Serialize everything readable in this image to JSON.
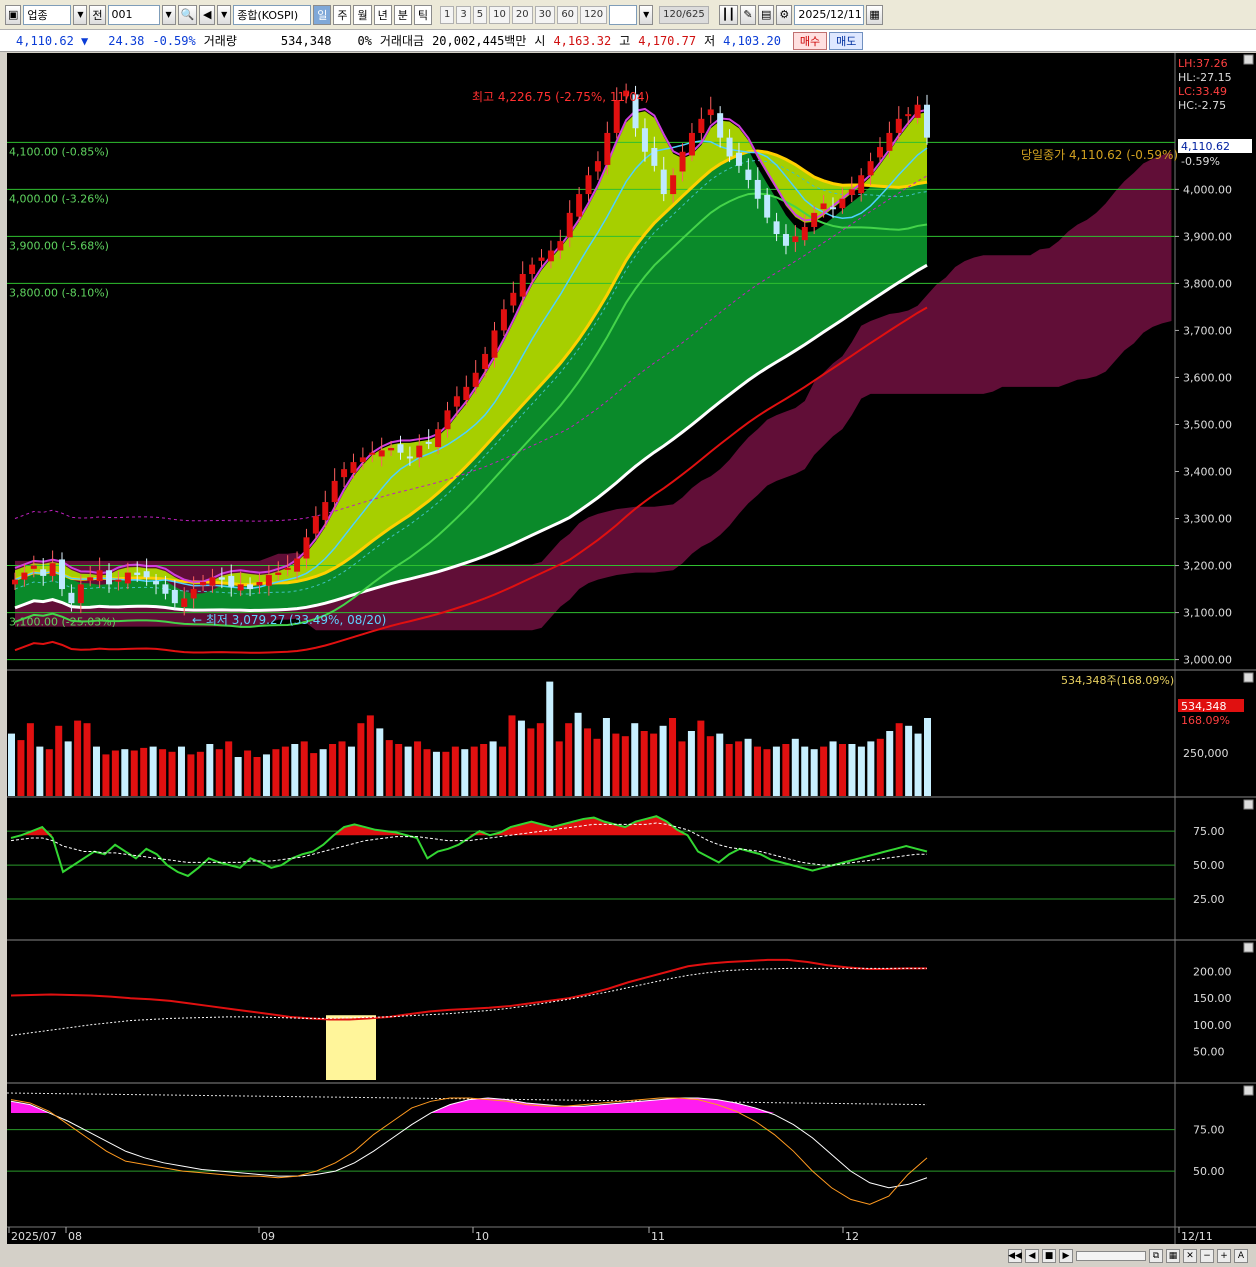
{
  "toolbar": {
    "market_select": "업종",
    "prev_label": "전",
    "code": "001",
    "name": "종합(KOSPI)",
    "periods": [
      "일",
      "주",
      "월",
      "년",
      "분",
      "틱"
    ],
    "active_period": "일",
    "intervals": [
      "1",
      "3",
      "5",
      "10",
      "20",
      "30",
      "60",
      "120"
    ],
    "count": "120",
    "total": "/625",
    "date": "2025/12/11"
  },
  "quote": {
    "price": "4,110.62",
    "change": "24.38",
    "change_pct": "-0.59%",
    "volume_label": "거래량",
    "volume": "534,348",
    "volume_pct": "0%",
    "amount_label": "거래대금",
    "amount": "20,002,445백만",
    "open_label": "시",
    "open": "4,163.32",
    "high_label": "고",
    "high": "4,170.77",
    "low_label": "저",
    "low": "4,103.20",
    "buy": "매수",
    "sell": "매도"
  },
  "chart_data": [
    {
      "type": "candlestick",
      "title": "",
      "x_labels": [
        "2025/07",
        "08",
        "09",
        "10",
        "11",
        "12",
        "12/11"
      ],
      "ylim": [
        2980,
        4290
      ],
      "y_ticks": [
        3000,
        3100,
        3200,
        3300,
        3400,
        3500,
        3600,
        3700,
        3800,
        3900,
        4000,
        4100
      ],
      "y_tick_labels": [
        "3,000.00",
        "3,100.00",
        "3,200.00",
        "3,300.00",
        "3,400.00",
        "3,500.00",
        "3,600.00",
        "3,700.00",
        "3,800.00",
        "3,900.00",
        "4,000.00"
      ],
      "level_lines": [
        {
          "price": 4100,
          "label": "4,100.00 (-0.85%)"
        },
        {
          "price": 4000,
          "label": "4,000.00 (-3.26%)"
        },
        {
          "price": 3900,
          "label": "3,900.00 (-5.68%)"
        },
        {
          "price": 3800,
          "label": "3,800.00 (-8.10%)"
        },
        {
          "price": 3200,
          "label": ""
        },
        {
          "price": 3100,
          "label": "3,100.00 (-25.03%)"
        },
        {
          "price": 3000,
          "label": ""
        }
      ],
      "annotations": {
        "high": "최고 4,226.75 (-2.75%, 11/04)",
        "low": "최저 3,079.27 (33.49%, 08/20)",
        "prev_close": "당일종가 4,110.62 (-0.59%)",
        "last_price": "4,110.62",
        "last_pct": "-0.59%",
        "lh": "LH:37.26",
        "hl": "HL:-27.15",
        "lc": "LC:33.49",
        "hc": "HC:-2.75"
      },
      "closes": [
        3170,
        3185,
        3200,
        3178,
        3205,
        3150,
        3120,
        3160,
        3175,
        3190,
        3160,
        3170,
        3185,
        3180,
        3175,
        3160,
        3140,
        3120,
        3130,
        3150,
        3165,
        3175,
        3170,
        3155,
        3160,
        3150,
        3165,
        3180,
        3185,
        3195,
        3215,
        3260,
        3305,
        3335,
        3380,
        3405,
        3420,
        3430,
        3440,
        3445,
        3450,
        3440,
        3430,
        3455,
        3460,
        3490,
        3530,
        3560,
        3580,
        3610,
        3650,
        3700,
        3745,
        3780,
        3820,
        3840,
        3855,
        3870,
        3890,
        3950,
        3990,
        4030,
        4060,
        4120,
        4190,
        4210,
        4130,
        4080,
        4050,
        3990,
        4030,
        4080,
        4120,
        4150,
        4170,
        4110,
        4070,
        4050,
        4020,
        3980,
        3940,
        3905,
        3880,
        3900,
        3920,
        3950,
        3970,
        3960,
        3980,
        4000,
        4030,
        4060,
        4090,
        4120,
        4150,
        4160,
        4180,
        4110
      ]
    },
    {
      "type": "bar",
      "title": "",
      "label": "534,348주(168.09%)",
      "last_value": "534,348",
      "last_pct": "168.09%",
      "y_ticks": [
        250000
      ],
      "y_tick_labels": [
        "250,000"
      ],
      "values": [
        480,
        430,
        560,
        380,
        360,
        540,
        420,
        580,
        560,
        380,
        320,
        350,
        360,
        350,
        370,
        380,
        360,
        340,
        380,
        320,
        340,
        400,
        360,
        420,
        300,
        350,
        300,
        320,
        360,
        380,
        400,
        420,
        330,
        360,
        400,
        420,
        380,
        560,
        620,
        520,
        430,
        400,
        380,
        420,
        360,
        340,
        340,
        380,
        360,
        380,
        400,
        420,
        380,
        620,
        580,
        520,
        560,
        880,
        420,
        560,
        640,
        520,
        440,
        600,
        480,
        460,
        560,
        500,
        480,
        540,
        600,
        420,
        500,
        580,
        460,
        480,
        400,
        420,
        440,
        380,
        360,
        380,
        400,
        440,
        380,
        360,
        380,
        420,
        400,
        400,
        380,
        420,
        440,
        500,
        560,
        540,
        480,
        600
      ]
    },
    {
      "type": "line",
      "title": "",
      "y_ticks": [
        25,
        50,
        75
      ],
      "y_tick_labels": [
        "25.00",
        "50.00",
        "75.00"
      ],
      "series": [
        {
          "values": [
            70,
            72,
            75,
            78,
            70,
            45,
            50,
            55,
            60,
            58,
            65,
            60,
            55,
            62,
            58,
            50,
            45,
            42,
            48,
            55,
            52,
            50,
            48,
            55,
            52,
            48,
            50,
            55,
            58,
            60,
            65,
            72,
            78,
            80,
            78,
            76,
            75,
            74,
            72,
            70,
            55,
            60,
            62,
            65,
            70,
            75,
            72,
            74,
            78,
            80,
            82,
            80,
            78,
            80,
            82,
            84,
            85,
            82,
            80,
            78,
            82,
            84,
            86,
            82,
            76,
            72,
            60,
            56,
            52,
            58,
            62,
            60,
            58,
            54,
            52,
            50,
            48,
            46,
            48,
            50,
            52,
            54,
            56,
            58,
            60,
            62,
            64,
            62,
            60
          ]
        },
        {
          "values": [
            68,
            69,
            70,
            70,
            68,
            64,
            62,
            60,
            60,
            59,
            59,
            58,
            57,
            56,
            55,
            54,
            53,
            52,
            52,
            52,
            52,
            52,
            52,
            53,
            53,
            53,
            54,
            55,
            56,
            58,
            60,
            62,
            64,
            66,
            68,
            69,
            70,
            71,
            71,
            71,
            70,
            69,
            68,
            68,
            68,
            69,
            70,
            71,
            72,
            73,
            74,
            75,
            76,
            77,
            78,
            79,
            80,
            80,
            80,
            80,
            80,
            80,
            81,
            80,
            78,
            76,
            72,
            68,
            65,
            63,
            62,
            61,
            60,
            58,
            56,
            54,
            52,
            51,
            50,
            50,
            51,
            52,
            53,
            54,
            55,
            56,
            57,
            58,
            58
          ]
        }
      ]
    },
    {
      "type": "line",
      "title": "",
      "y_ticks": [
        50,
        100,
        150,
        200
      ],
      "y_tick_labels": [
        "50.00",
        "100.00",
        "150.00",
        "200.00"
      ],
      "series": [
        {
          "values": [
            155,
            156,
            157,
            156,
            155,
            153,
            150,
            148,
            145,
            140,
            135,
            130,
            125,
            120,
            115,
            112,
            110,
            110,
            112,
            115,
            120,
            125,
            128,
            130,
            132,
            135,
            140,
            145,
            150,
            158,
            168,
            180,
            190,
            200,
            210,
            215,
            218,
            220,
            222,
            222,
            218,
            212,
            208,
            205,
            205,
            206,
            206
          ]
        },
        {
          "values": [
            80,
            85,
            90,
            95,
            100,
            104,
            108,
            110,
            112,
            113,
            114,
            115,
            115,
            114,
            113,
            112,
            112,
            113,
            114,
            115,
            117,
            119,
            121,
            124,
            127,
            131,
            136,
            142,
            148,
            155,
            162,
            170,
            178,
            186,
            193,
            198,
            202,
            204,
            205,
            206,
            206,
            206,
            206,
            206,
            206,
            206,
            206
          ]
        }
      ]
    },
    {
      "type": "line",
      "title": "",
      "y_ticks": [
        50,
        75
      ],
      "y_tick_labels": [
        "50.00",
        "75.00"
      ],
      "series": [
        {
          "values": [
            92,
            90,
            85,
            80,
            74,
            68,
            62,
            58,
            55,
            53,
            51,
            50,
            49,
            48,
            47,
            47,
            48,
            50,
            55,
            62,
            70,
            78,
            85,
            90,
            93,
            94,
            93,
            91,
            90,
            89,
            89,
            90,
            91,
            92,
            93,
            94,
            94,
            93,
            91,
            88,
            84,
            78,
            70,
            60,
            50,
            43,
            40,
            42,
            46
          ]
        },
        {
          "values": [
            93,
            91,
            86,
            78,
            70,
            62,
            56,
            54,
            52,
            50,
            49,
            48,
            47,
            47,
            46,
            47,
            50,
            55,
            62,
            72,
            80,
            88,
            92,
            94,
            94,
            93,
            92,
            90,
            89,
            89,
            90,
            91,
            92,
            93,
            94,
            94,
            93,
            90,
            86,
            80,
            72,
            62,
            50,
            40,
            33,
            30,
            35,
            48,
            58
          ]
        }
      ]
    }
  ],
  "x_axis_labels": [
    "2025/07",
    "08",
    "09",
    "10",
    "11",
    "12",
    "12/11"
  ]
}
